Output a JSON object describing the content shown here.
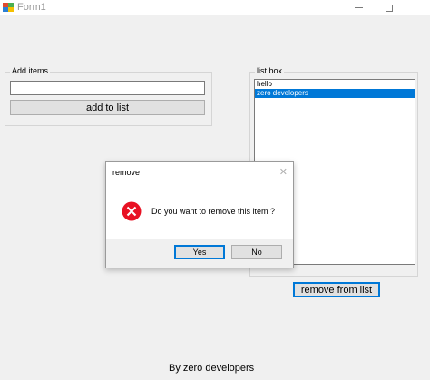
{
  "window": {
    "title": "Form1",
    "accent": "#0078d7"
  },
  "add_group": {
    "label": "Add items",
    "textbox_value": "",
    "add_button_label": "add to list"
  },
  "list_group": {
    "label": "list box",
    "items": [
      {
        "text": "hello",
        "selected": false
      },
      {
        "text": "zero developers",
        "selected": true
      }
    ]
  },
  "remove_button_label": "remove from list",
  "footer_text": "By zero developers",
  "dialog": {
    "title": "remove",
    "close_glyph": "✕",
    "message": "Do you want to remove this item ?",
    "icon": "error-icon",
    "yes_label": "Yes",
    "no_label": "No"
  }
}
